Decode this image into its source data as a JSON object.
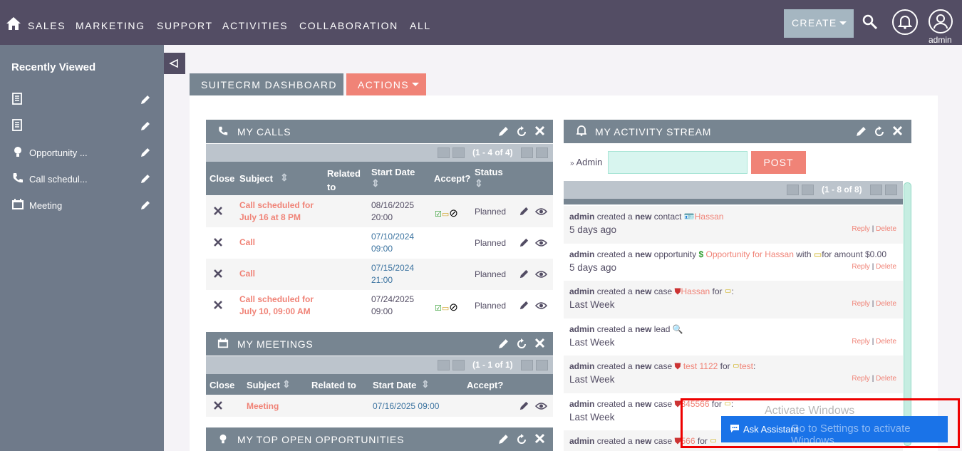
{
  "nav": {
    "items": [
      "SALES",
      "MARKETING",
      "SUPPORT",
      "ACTIVITIES",
      "COLLABORATION",
      "ALL"
    ],
    "create_label": "CREATE",
    "user_label": "admin"
  },
  "sidebar": {
    "title": "Recently Viewed",
    "items": [
      {
        "label": "",
        "icon": "document-icon"
      },
      {
        "label": "",
        "icon": "document-icon"
      },
      {
        "label": "Opportunity ...",
        "icon": "lightbulb-icon"
      },
      {
        "label": "Call schedul...",
        "icon": "phone-icon"
      },
      {
        "label": "Meeting",
        "icon": "calendar-icon"
      }
    ]
  },
  "tabs": {
    "dashboard": "SUITECRM DASHBOARD",
    "actions": "ACTIONS"
  },
  "calls": {
    "title": "MY CALLS",
    "pager": "(1 - 4 of 4)",
    "headers": {
      "close": "Close",
      "subject": "Subject",
      "related": "Related to",
      "start": "Start Date",
      "accept": "Accept?",
      "status": "Status"
    },
    "rows": [
      {
        "subject": "Call scheduled for July 16 at 8 PM",
        "date": "08/16/2025 20:00",
        "status": "Planned",
        "accept": true
      },
      {
        "subject": "Call",
        "date": "07/10/2024 09:00",
        "status": "Planned",
        "accept": false
      },
      {
        "subject": "Call",
        "date": "07/15/2024 21:00",
        "status": "Planned",
        "accept": false
      },
      {
        "subject": "Call scheduled for July 10, 09:00 AM",
        "date": "07/24/2025 09:00",
        "status": "Planned",
        "accept": true
      }
    ]
  },
  "meetings": {
    "title": "MY MEETINGS",
    "pager": "(1 - 1 of 1)",
    "headers": {
      "close": "Close",
      "subject": "Subject",
      "related": "Related to",
      "start": "Start Date",
      "accept": "Accept?"
    },
    "rows": [
      {
        "subject": "Meeting",
        "date": "07/16/2025 09:00"
      }
    ]
  },
  "opportunities": {
    "title": "MY TOP OPEN OPPORTUNITIES"
  },
  "stream": {
    "title": "MY ACTIVITY STREAM",
    "user": "Admin",
    "post_label": "POST",
    "pager": "(1 - 8 of 8)",
    "reply": "Reply",
    "delete": "Delete",
    "items": [
      {
        "actor": "admin",
        "a": "created a",
        "b": "new",
        "c": "contact",
        "link": "Hassan",
        "mid": "",
        "link2": "",
        "tail": "",
        "time": "5 days ago"
      },
      {
        "actor": "admin",
        "a": "created a",
        "b": "new",
        "c": "opportunity",
        "link": "Opportunity for Hassan",
        "mid": "with",
        "link2": "",
        "tail": "for amount $0.00",
        "time": "5 days ago"
      },
      {
        "actor": "admin",
        "a": "created a",
        "b": "new",
        "c": "case",
        "link": "Hassan",
        "mid": "for",
        "link2": "",
        "tail": ":",
        "time": "Last Week"
      },
      {
        "actor": "admin",
        "a": "created a",
        "b": "new",
        "c": "lead",
        "link": "",
        "mid": "",
        "link2": "",
        "tail": "",
        "time": "Last Week"
      },
      {
        "actor": "admin",
        "a": "created a",
        "b": "new",
        "c": "case",
        "link": "test 1122",
        "mid": "for",
        "link2": "test",
        "tail": ":",
        "time": "Last Week"
      },
      {
        "actor": "admin",
        "a": "created a",
        "b": "new",
        "c": "case",
        "link": "345566",
        "mid": "for",
        "link2": "",
        "tail": ":",
        "time": "Last Week"
      },
      {
        "actor": "admin",
        "a": "created a",
        "b": "new",
        "c": "case",
        "link": "566",
        "mid": "for",
        "link2": "",
        "tail": "",
        "time": ""
      }
    ]
  },
  "overlay": {
    "ask_label": "Ask Assistant",
    "watermark1": "Activate Windows",
    "watermark2": "Go to Settings to activate Windows."
  },
  "colors": {
    "topbar": "#534d64",
    "sidebar": "#6f7a8a",
    "accent": "#f08377",
    "dashlet_header": "#778591"
  }
}
